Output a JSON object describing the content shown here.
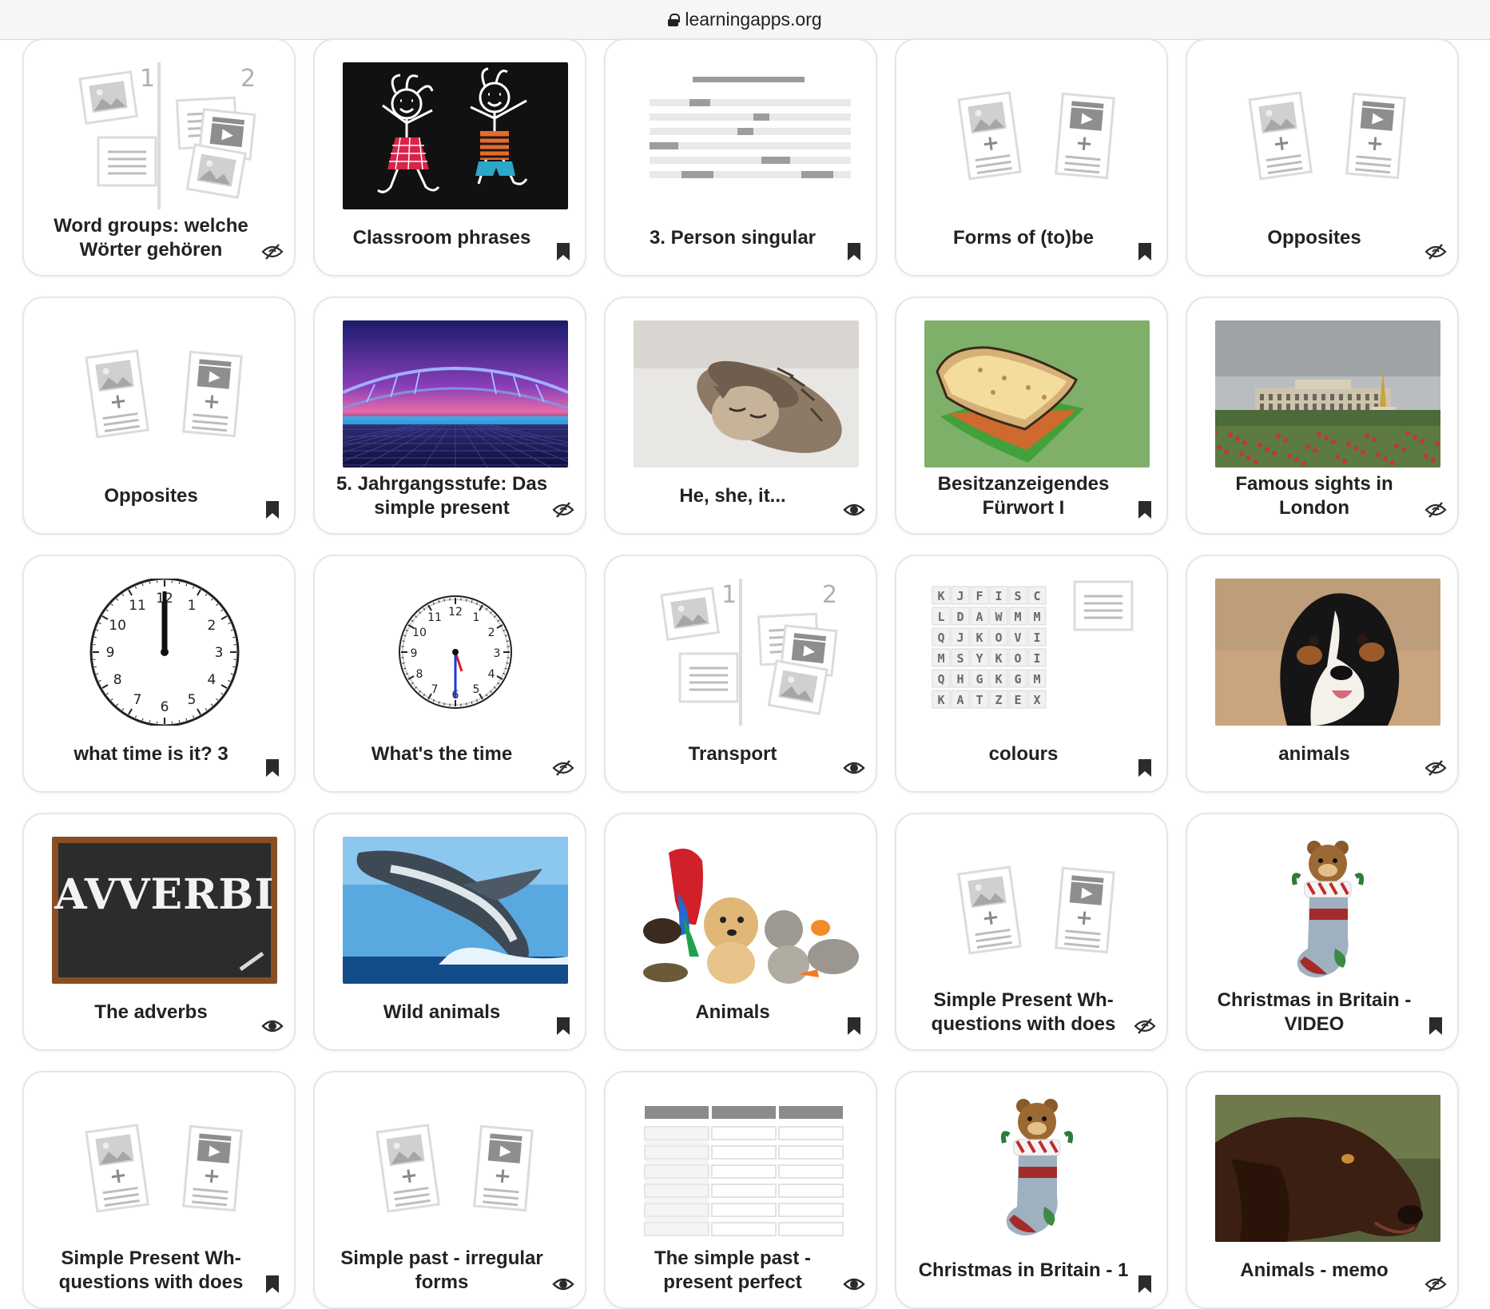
{
  "browser": {
    "url": "learningapps.org"
  },
  "cards": [
    {
      "title": "Word groups: welche Wörter gehören",
      "thumb": "group-assignment",
      "status": "hidden"
    },
    {
      "title": "Classroom phrases",
      "thumb": "chalk-kids",
      "status": "bookmark"
    },
    {
      "title": "3. Person singular",
      "thumb": "cloze-text",
      "status": "bookmark"
    },
    {
      "title": "Forms of (to)be",
      "thumb": "matching-pairs",
      "status": "bookmark"
    },
    {
      "title": "Opposites",
      "thumb": "matching-pairs",
      "status": "hidden"
    },
    {
      "title": "Opposites",
      "thumb": "matching-pairs",
      "status": "bookmark"
    },
    {
      "title": "5. Jahrgangsstufe: Das simple present",
      "thumb": "neon-bridge",
      "status": "hidden"
    },
    {
      "title": "He, she, it...",
      "thumb": "sleeping-cat",
      "status": "visible"
    },
    {
      "title": "Besitzanzeigendes Fürwort I",
      "thumb": "sandwich",
      "status": "bookmark"
    },
    {
      "title": "Famous sights in London",
      "thumb": "palace",
      "status": "hidden"
    },
    {
      "title": "what time is it? 3",
      "thumb": "clock-large",
      "status": "bookmark"
    },
    {
      "title": "What's the time",
      "thumb": "clock-small",
      "status": "hidden"
    },
    {
      "title": "Transport",
      "thumb": "group-assignment",
      "status": "visible"
    },
    {
      "title": "colours",
      "thumb": "word-grid",
      "status": "bookmark"
    },
    {
      "title": "animals",
      "thumb": "dog",
      "status": "hidden"
    },
    {
      "title": "The adverbs",
      "thumb": "chalkboard",
      "status": "visible"
    },
    {
      "title": "Wild animals",
      "thumb": "whale",
      "status": "bookmark"
    },
    {
      "title": "Animals",
      "thumb": "pets",
      "status": "bookmark"
    },
    {
      "title": "Simple Present Wh-questions with does",
      "thumb": "matching-pairs",
      "status": "hidden"
    },
    {
      "title": "Christmas in Britain - VIDEO",
      "thumb": "stocking",
      "status": "bookmark"
    },
    {
      "title": "Simple Present Wh-questions with does",
      "thumb": "matching-pairs",
      "status": "bookmark"
    },
    {
      "title": "Simple past - irregular forms",
      "thumb": "matching-pairs",
      "status": "visible"
    },
    {
      "title": "The simple past - present perfect",
      "thumb": "table-grid",
      "status": "visible"
    },
    {
      "title": "Christmas in Britain - 1",
      "thumb": "stocking",
      "status": "bookmark"
    },
    {
      "title": "Animals - memo",
      "thumb": "brown-dog",
      "status": "hidden"
    }
  ],
  "thumb_text": {
    "avverbi": "AVVERBI",
    "word_grid": [
      [
        "K",
        "J",
        "F",
        "I",
        "S",
        "C"
      ],
      [
        "L",
        "D",
        "A",
        "W",
        "M",
        "M"
      ],
      [
        "Q",
        "J",
        "K",
        "O",
        "V",
        "I"
      ],
      [
        "M",
        "S",
        "Y",
        "K",
        "O",
        "I"
      ],
      [
        "Q",
        "H",
        "G",
        "K",
        "G",
        "M"
      ],
      [
        "K",
        "A",
        "T",
        "Z",
        "E",
        "X"
      ]
    ],
    "clock_large_numbers": [
      "12",
      "1",
      "2",
      "3",
      "4",
      "5",
      "6",
      "7",
      "8",
      "9",
      "10",
      "11"
    ],
    "clock_small_numbers": [
      "12",
      "1",
      "2",
      "3",
      "4",
      "5",
      "6",
      "7",
      "8",
      "9",
      "10",
      "11"
    ],
    "group_labels": [
      "1",
      "2"
    ]
  },
  "colors": {
    "card_border": "#e6e6e6",
    "icon_gray": "#2b2b2b",
    "placeholder_gray": "#b9b9b9"
  }
}
